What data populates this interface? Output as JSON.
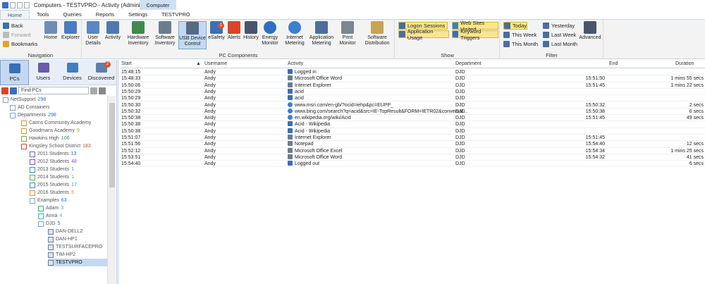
{
  "window": {
    "title": "Computers - TESTVPRO - Activity (Administrator)"
  },
  "context_group": {
    "label": "Computer"
  },
  "tabs": [
    {
      "label": "Home"
    },
    {
      "label": "Tools"
    },
    {
      "label": "Queries"
    },
    {
      "label": "Reports"
    },
    {
      "label": "Settings"
    },
    {
      "label": "TESTVPRO"
    }
  ],
  "ribbon": {
    "navigation": {
      "back": "Back",
      "forward": "Forward",
      "bookmarks": "Bookmarks",
      "home": "Home",
      "explorer": "Explorer",
      "label": "Navigation"
    },
    "pc_components": {
      "label": "PC Components",
      "buttons": [
        {
          "label": "User\nDetails"
        },
        {
          "label": "Activity"
        },
        {
          "label": "Hardware\nInventory"
        },
        {
          "label": "Software\nInventory"
        },
        {
          "label": "USB Device\nControl"
        },
        {
          "label": "eSafety"
        },
        {
          "label": "Alerts"
        },
        {
          "label": "History"
        },
        {
          "label": "Energy\nMonitor"
        },
        {
          "label": "Internet\nMetering"
        },
        {
          "label": "Application\nMetering"
        },
        {
          "label": "Print\nMonitor"
        },
        {
          "label": "Software\nDistribution"
        }
      ],
      "alerts_badge": "1"
    },
    "show": {
      "label": "Show",
      "items": [
        "Logon Sessions",
        "Application Usage",
        "Web Sites Visited",
        "Keyword Triggers"
      ]
    },
    "filter": {
      "label": "Filter",
      "items": [
        "Today",
        "This Week",
        "This Month",
        "Yesterday",
        "Last Week",
        "Last Month"
      ],
      "advanced": "Advanced"
    }
  },
  "view_tabs": [
    {
      "label": "PCs"
    },
    {
      "label": "Users"
    },
    {
      "label": "Devices"
    },
    {
      "label": "Discovered",
      "badge": "2"
    }
  ],
  "search": {
    "placeholder": "Find PCs"
  },
  "tree": [
    {
      "label": "NetSupport",
      "count": "298"
    },
    {
      "label": "AD Containers",
      "count": ""
    },
    {
      "label": "Departments",
      "count": "298"
    },
    {
      "label": "Cairns Community Academy",
      "count": ""
    },
    {
      "label": "Goodmans Academy",
      "count": "9"
    },
    {
      "label": "Hawkins High",
      "count": "106"
    },
    {
      "label": "Kingsley School District",
      "count": "183"
    },
    {
      "label": "2011 Students",
      "count": "13"
    },
    {
      "label": "2012 Students",
      "count": "48"
    },
    {
      "label": "2013 Students",
      "count": "1"
    },
    {
      "label": "2014 Students",
      "count": "1"
    },
    {
      "label": "2015 Students",
      "count": "17"
    },
    {
      "label": "2016 Students",
      "count": "5"
    },
    {
      "label": "Examples",
      "count": "63"
    },
    {
      "label": "Adam",
      "count": "3"
    },
    {
      "label": "Anna",
      "count": "4"
    },
    {
      "label": "DJD",
      "count": "5"
    },
    {
      "label": "DAN-DELL2",
      "count": ""
    },
    {
      "label": "DAN-HP1",
      "count": ""
    },
    {
      "label": "TESTSURFACEPRO",
      "count": ""
    },
    {
      "label": "TIM-HP2",
      "count": ""
    },
    {
      "label": "TESTVPRO",
      "count": ""
    }
  ],
  "grid": {
    "columns": [
      "Start",
      "Username",
      "Activity",
      "Department",
      "End",
      "Duration"
    ],
    "rows": [
      {
        "start": "15:48:15",
        "user": "Andy",
        "activity": "Logged in",
        "dept": "DJD",
        "end": "",
        "duration": "",
        "icon": "user-icon"
      },
      {
        "start": "15:48:33",
        "user": "Andy",
        "activity": "Microsoft Office Word",
        "dept": "DJD",
        "end": "15:51:50",
        "duration": "1 mins 55 secs",
        "icon": "app-icon"
      },
      {
        "start": "15:50:06",
        "user": "Andy",
        "activity": "Internet Explorer",
        "dept": "DJD",
        "end": "15:51:45",
        "duration": "1 mins 22 secs",
        "icon": "app-icon"
      },
      {
        "start": "15:50:29",
        "user": "Andy",
        "activity": "acid",
        "dept": "DJD",
        "end": "",
        "duration": "",
        "icon": "shield-icon"
      },
      {
        "start": "15:50:29",
        "user": "Andy",
        "activity": "acid",
        "dept": "DJD",
        "end": "",
        "duration": "",
        "icon": "shield-icon"
      },
      {
        "start": "15:50:30",
        "user": "Andy",
        "activity": "www.msn.com/en-gb/?ocid=iehp&pc=EUPP_",
        "dept": "DJD",
        "end": "15:50:32",
        "duration": "2 secs",
        "icon": "globe-icon"
      },
      {
        "start": "15:50:32",
        "user": "Andy",
        "activity": "www.bing.com/search?q=acid&src=IE-TopResult&FORM=IETR02&conversat...",
        "dept": "DJD",
        "end": "15:50:38",
        "duration": "6 secs",
        "icon": "globe-icon"
      },
      {
        "start": "15:50:38",
        "user": "Andy",
        "activity": "en.wikipedia.org/wiki/Acid",
        "dept": "DJD",
        "end": "15:51:45",
        "duration": "49 secs",
        "icon": "globe-icon"
      },
      {
        "start": "15:50:38",
        "user": "Andy",
        "activity": "Acid - Wikipedia",
        "dept": "DJD",
        "end": "",
        "duration": "",
        "icon": "shield-icon"
      },
      {
        "start": "15:50:38",
        "user": "Andy",
        "activity": "Acid - Wikipedia",
        "dept": "DJD",
        "end": "",
        "duration": "",
        "icon": "shield-icon"
      },
      {
        "start": "15:51:07",
        "user": "Andy",
        "activity": "Internet Explorer",
        "dept": "DJD",
        "end": "15:51:45",
        "duration": "",
        "icon": "app-icon"
      },
      {
        "start": "15:51:56",
        "user": "Andy",
        "activity": "Notepad",
        "dept": "DJD",
        "end": "15:54:40",
        "duration": "12 secs",
        "icon": "app-icon"
      },
      {
        "start": "15:52:12",
        "user": "Andy",
        "activity": "Microsoft Office Excel",
        "dept": "DJD",
        "end": "15:54:34",
        "duration": "1 mins 25 secs",
        "icon": "app-icon"
      },
      {
        "start": "15:53:51",
        "user": "Andy",
        "activity": "Microsoft Office Word",
        "dept": "DJD",
        "end": "15:54:32",
        "duration": "41 secs",
        "icon": "app-icon"
      },
      {
        "start": "15:54:40",
        "user": "Andy",
        "activity": "Logged out",
        "dept": "DJD",
        "end": "",
        "duration": "6 secs",
        "icon": "user-icon"
      }
    ]
  }
}
